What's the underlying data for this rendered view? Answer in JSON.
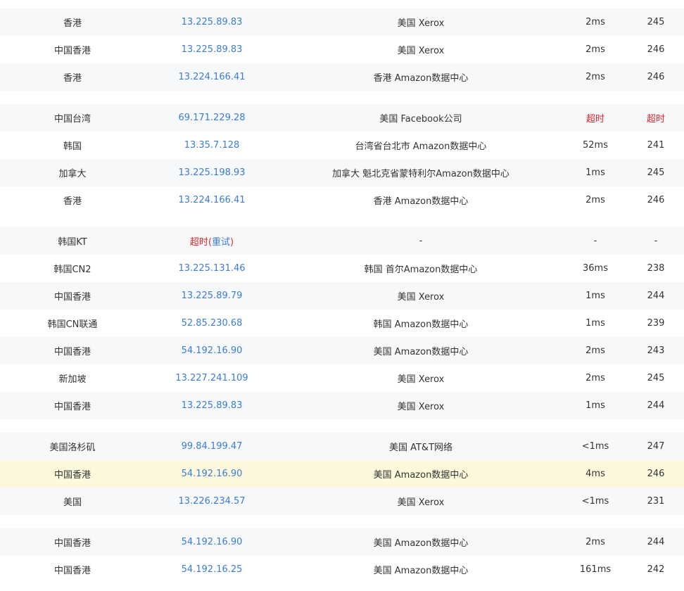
{
  "colors": {
    "ip_link": "#3b7cd6",
    "timeout": "#e0262a",
    "highlight_row": "#fbf8dc",
    "stripe_row": "#f7f8fa"
  },
  "groups": [
    [
      {
        "node": "香港",
        "ip": "13.225.89.83",
        "location": "美国 Xerox",
        "latency": "2ms",
        "ttl": "245"
      },
      {
        "node": "中国香港",
        "ip": "13.225.89.83",
        "location": "美国 Xerox",
        "latency": "2ms",
        "ttl": "246"
      },
      {
        "node": "香港",
        "ip": "13.224.166.41",
        "location": "香港 Amazon数据中心",
        "latency": "2ms",
        "ttl": "246"
      }
    ],
    [
      {
        "node": "中国台湾",
        "ip": "69.171.229.28",
        "location": "美国 Facebook公司",
        "latency": "超时",
        "ttl": "超时",
        "latency_timeout": true,
        "ttl_timeout": true
      },
      {
        "node": "韩国",
        "ip": "13.35.7.128",
        "location": "台湾省台北市 Amazon数据中心",
        "latency": "52ms",
        "ttl": "241"
      },
      {
        "node": "加拿大",
        "ip": "13.225.198.93",
        "location": "加拿大 魁北克省蒙特利尔Amazon数据中心",
        "latency": "1ms",
        "ttl": "245"
      },
      {
        "node": "香港",
        "ip": "13.224.166.41",
        "location": "香港 Amazon数据中心",
        "latency": "2ms",
        "ttl": "246"
      }
    ],
    [
      {
        "node": "韩国KT",
        "ip_timeout": "超时",
        "retry_open": "(",
        "retry": "重试",
        "retry_close": ")",
        "location": "-",
        "latency": "-",
        "ttl": "-"
      },
      {
        "node": "韩国CN2",
        "ip": "13.225.131.46",
        "location": "韩国 首尔Amazon数据中心",
        "latency": "36ms",
        "ttl": "238"
      },
      {
        "node": "中国香港",
        "ip": "13.225.89.79",
        "location": "美国 Xerox",
        "latency": "1ms",
        "ttl": "244"
      },
      {
        "node": "韩国CN联通",
        "ip": "52.85.230.68",
        "location": "韩国 Amazon数据中心",
        "latency": "1ms",
        "ttl": "239"
      },
      {
        "node": "中国香港",
        "ip": "54.192.16.90",
        "location": "美国 Amazon数据中心",
        "latency": "2ms",
        "ttl": "243"
      },
      {
        "node": "新加坡",
        "ip": "13.227.241.109",
        "location": "美国 Xerox",
        "latency": "2ms",
        "ttl": "245"
      },
      {
        "node": "中国香港",
        "ip": "13.225.89.83",
        "location": "美国 Xerox",
        "latency": "1ms",
        "ttl": "244"
      }
    ],
    [
      {
        "node": "美国洛杉矶",
        "ip": "99.84.199.47",
        "location": "美国 AT&T网络",
        "latency": "<1ms",
        "ttl": "247"
      },
      {
        "node": "中国香港",
        "ip": "54.192.16.90",
        "location": "美国 Amazon数据中心",
        "latency": "4ms",
        "ttl": "246",
        "highlight": true
      },
      {
        "node": "美国",
        "ip": "13.226.234.57",
        "location": "美国 Xerox",
        "latency": "<1ms",
        "ttl": "231"
      }
    ],
    [
      {
        "node": "中国香港",
        "ip": "54.192.16.90",
        "location": "美国 Amazon数据中心",
        "latency": "2ms",
        "ttl": "244"
      },
      {
        "node": "中国香港",
        "ip": "54.192.16.25",
        "location": "美国 Amazon数据中心",
        "latency": "161ms",
        "ttl": "242"
      }
    ]
  ]
}
